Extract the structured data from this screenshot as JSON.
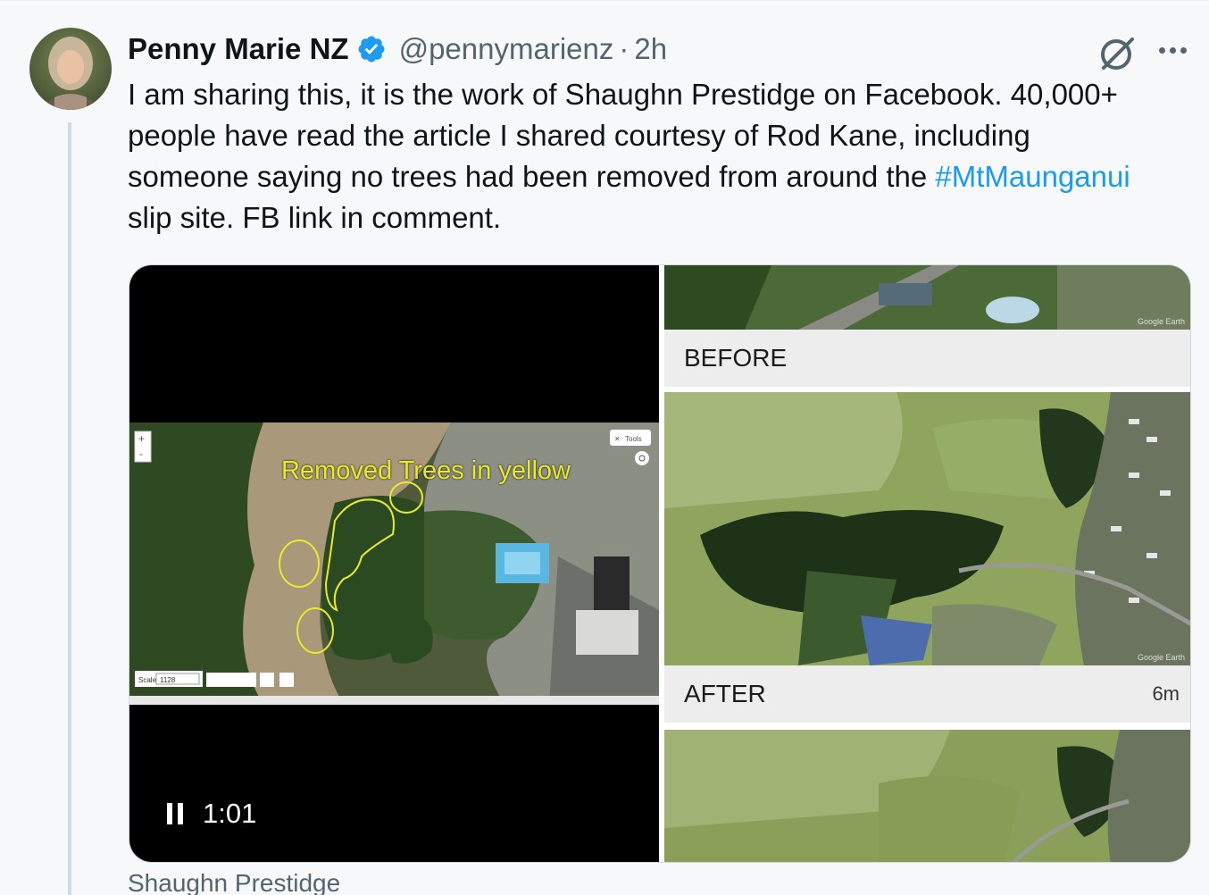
{
  "author": {
    "name": "Penny Marie NZ",
    "handle": "@pennymarienz",
    "separator": "·",
    "time": "2h"
  },
  "tweet": {
    "text_part1": "I am sharing this, it is the work of Shaughn Prestidge on Facebook. 40,000+ people have read the article I shared courtesy of Rod Kane, including someone saying no trees had been removed from around the ",
    "hashtag": "#MtMaunganui",
    "text_part2": " slip site. FB link in comment."
  },
  "media": {
    "video": {
      "overlay_text": "Removed Trees in yellow",
      "duration": "1:01",
      "scale_label": "Scale",
      "scale_value": "1128",
      "tools_label": "Tools"
    },
    "before_label": "BEFORE",
    "after_label": "AFTER",
    "after_time": "6m",
    "watermark": "Google Earth"
  },
  "card_source": "Shaughn Prestidge",
  "colors": {
    "accent": "#1d9bf0",
    "overlay_yellow": "#e9ea2a",
    "verified": "#1d9bf0"
  },
  "icons": [
    "verified-badge-icon",
    "grok-icon",
    "more-options-icon",
    "pause-icon",
    "zoom-in-icon",
    "zoom-out-icon",
    "tools-icon",
    "locate-icon"
  ]
}
